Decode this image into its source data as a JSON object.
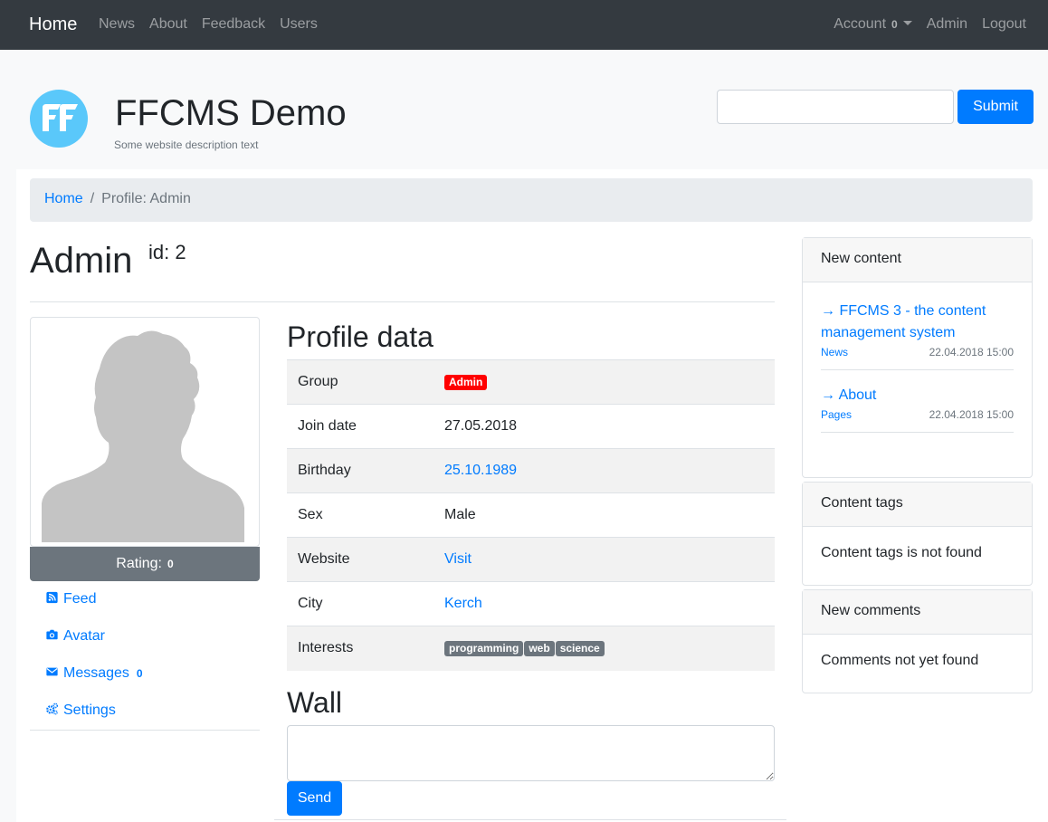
{
  "navbar": {
    "brand": "Home",
    "links": [
      "News",
      "About",
      "Feedback",
      "Users"
    ],
    "account_label": "Account",
    "account_count": "0",
    "admin_label": "Admin",
    "logout_label": "Logout"
  },
  "header": {
    "title": "FFCMS Demo",
    "description": "Some website description text",
    "search_value": "",
    "search_button": "Submit"
  },
  "breadcrumb": {
    "home": "Home",
    "separator": "/",
    "current": "Profile: Admin"
  },
  "profile": {
    "name": "Admin",
    "id_label": "id: 2",
    "rating_label": "Rating:",
    "rating_value": "0",
    "menu": [
      {
        "label": "Feed",
        "icon": "rss-icon"
      },
      {
        "label": "Avatar",
        "icon": "camera-icon"
      },
      {
        "label": "Messages",
        "icon": "envelope-icon",
        "badge": "0"
      },
      {
        "label": "Settings",
        "icon": "cogs-icon"
      }
    ],
    "data_title": "Profile data",
    "rows": {
      "group_label": "Group",
      "group_value": "Admin",
      "join_label": "Join date",
      "join_value": "27.05.2018",
      "birthday_label": "Birthday",
      "birthday_value": "25.10.1989",
      "sex_label": "Sex",
      "sex_value": "Male",
      "website_label": "Website",
      "website_value": "Visit",
      "city_label": "City",
      "city_value": "Kerch",
      "interests_label": "Interests",
      "interests": [
        "programming",
        "web",
        "science"
      ]
    }
  },
  "wall": {
    "title": "Wall",
    "text_value": "",
    "send_button": "Send"
  },
  "sidebar": {
    "new_content": {
      "title": "New content",
      "items": [
        {
          "title": "→ FFCMS 3 - the content management system",
          "category": "News",
          "date": "22.04.2018 15:00"
        },
        {
          "title": "→ About",
          "category": "Pages",
          "date": "22.04.2018 15:00"
        }
      ]
    },
    "content_tags": {
      "title": "Content tags",
      "body": "Content tags is not found"
    },
    "new_comments": {
      "title": "New comments",
      "body": "Comments not yet found"
    }
  },
  "colors": {
    "navbar_bg": "#343a40",
    "primary": "#007bff",
    "secondary": "#6c757d",
    "danger": "#ff0000",
    "logo": "#5ac8fa"
  }
}
